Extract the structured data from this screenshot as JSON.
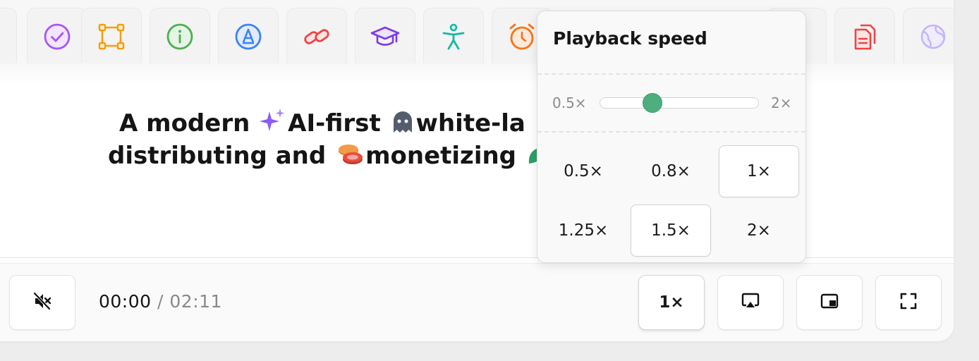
{
  "icon_strip": {
    "icons": [
      {
        "name": "check-circle-icon",
        "color": "#a855f7"
      },
      {
        "name": "bounding-box-icon",
        "color": "#f59e0b"
      },
      {
        "name": "info-circle-icon",
        "color": "#4caf50"
      },
      {
        "name": "letter-a-circle-icon",
        "color": "#3b82f6"
      },
      {
        "name": "link-icon",
        "color": "#ef4444"
      },
      {
        "name": "graduation-cap-icon",
        "color": "#7c3aed"
      },
      {
        "name": "accessibility-icon",
        "color": "#14b8a6"
      },
      {
        "name": "alarm-clock-icon",
        "color": "#f97316"
      },
      {
        "name": "partial-circle-icon",
        "color": "#3b82f6"
      },
      {
        "name": "copy-document-icon",
        "color": "#ef4444"
      },
      {
        "name": "globe-icon",
        "color": "#c4b5fd"
      }
    ]
  },
  "headline": {
    "line1": {
      "part1": "A modern",
      "emoji1": "sparkles-icon",
      "part2": "AI-first",
      "emoji2": "ghost-icon",
      "part3": "white-la"
    },
    "line2": {
      "part1": "distributing and",
      "emoji1": "coins-icon",
      "part2": "monetizing"
    }
  },
  "controls": {
    "mute_icon": "speaker-muted-icon",
    "current_time": "00:00",
    "separator": "/",
    "total_time": "02:11",
    "speed_label": "1×",
    "airplay_icon": "airplay-icon",
    "pip_icon": "picture-in-picture-icon",
    "fullscreen_icon": "fullscreen-icon"
  },
  "speed_popup": {
    "title": "Playback speed",
    "slider": {
      "min_label": "0.5×",
      "max_label": "2×",
      "min": 0.5,
      "max": 2,
      "value": 1
    },
    "options": [
      "0.5×",
      "0.8×",
      "1×",
      "1.25×",
      "1.5×",
      "2×"
    ],
    "selected": "1×",
    "accent_color": "#4caf7d"
  }
}
